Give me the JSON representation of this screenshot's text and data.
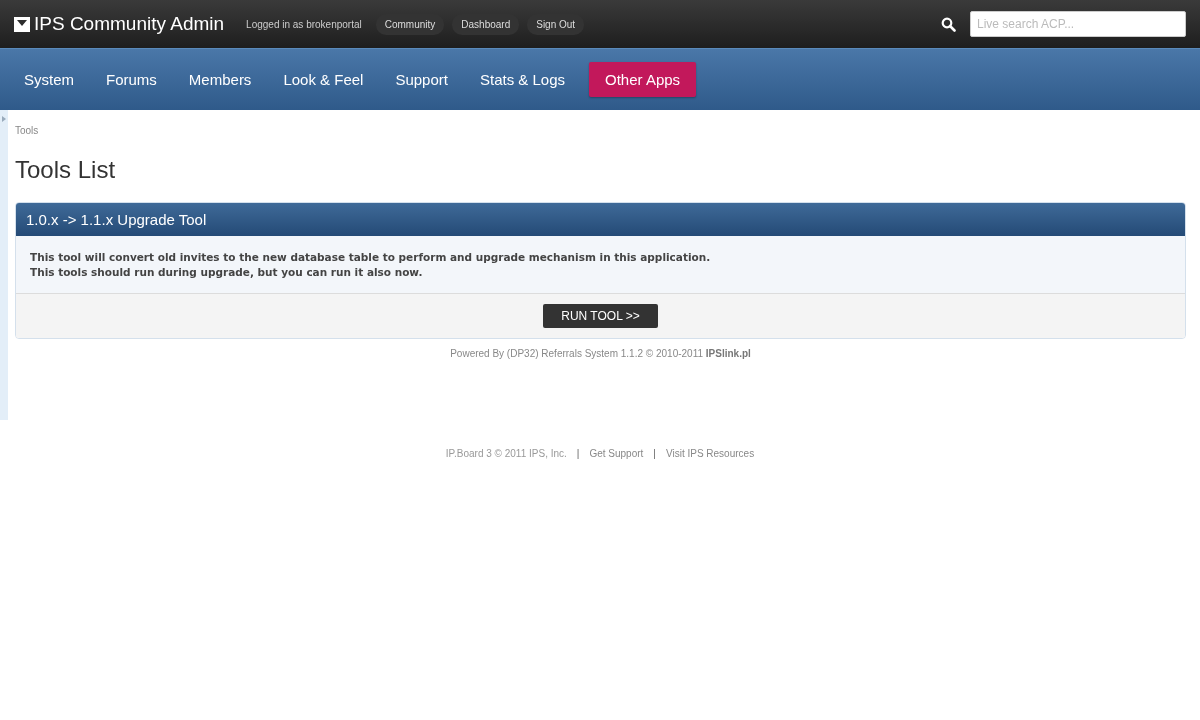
{
  "header": {
    "title": "IPS Community Admin",
    "logged_in": "Logged in as brokenportal",
    "links": [
      "Community",
      "Dashboard",
      "Sign Out"
    ],
    "search": {
      "placeholder": "Live search ACP..."
    }
  },
  "nav": [
    {
      "label": "System",
      "selected": false
    },
    {
      "label": "Forums",
      "selected": false
    },
    {
      "label": "Members",
      "selected": false
    },
    {
      "label": "Look & Feel",
      "selected": false
    },
    {
      "label": "Support",
      "selected": false
    },
    {
      "label": "Stats & Logs",
      "selected": false
    },
    {
      "label": "Other Apps",
      "selected": true
    }
  ],
  "breadcrumb": "Tools",
  "page_title": "Tools List",
  "panel": {
    "title": "1.0.x -> 1.1.x Upgrade Tool",
    "lines": [
      "This tool will convert old invites to the new database table to perform and upgrade mechanism in this application.",
      "This tools should run during upgrade, but you can run it also now."
    ],
    "button": "RUN TOOL >>"
  },
  "powered_by": "Powered By (DP32) Referrals System 1.1.2 © 2010-2011  **IPSlink.pl**",
  "footer": [
    {
      "kind": "text",
      "text": "IP.Board 3 © 2011 IPS, Inc."
    },
    {
      "kind": "separator",
      "text": "|"
    },
    {
      "kind": "link",
      "text": "Get Support"
    },
    {
      "kind": "separator",
      "text": "|"
    },
    {
      "kind": "link",
      "text": "Visit IPS Resources"
    }
  ]
}
